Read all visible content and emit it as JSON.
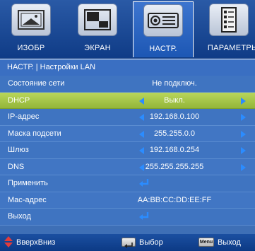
{
  "tabs": [
    {
      "label": "ИЗОБР",
      "icon": "image-settings-icon"
    },
    {
      "label": "ЭКРАН",
      "icon": "screen-icon"
    },
    {
      "label": "НАСТР.",
      "icon": "projector-icon"
    },
    {
      "label": "ПАРАМЕТРЫ",
      "icon": "options-list-icon"
    }
  ],
  "active_tab": "НАСТР.",
  "breadcrumb": "НАСТР. | Настройки LAN",
  "rows": [
    {
      "label": "Состояние сети",
      "value": "Не подключ."
    },
    {
      "label": "DHCP",
      "value": "Выкл."
    },
    {
      "label": "IP-адрес",
      "value": "192.168.0.100"
    },
    {
      "label": "Маска подсети",
      "value": "255.255.0.0"
    },
    {
      "label": "Шлюз",
      "value": "192.168.0.254"
    },
    {
      "label": "DNS",
      "value": "255.255.255.255"
    },
    {
      "label": "Применить",
      "value": ""
    },
    {
      "label": "Mac-адрес",
      "value": "AA:BB:CC:DD:EE:FF"
    },
    {
      "label": "Выход",
      "value": ""
    }
  ],
  "footer": {
    "updown_label": "ВверхВниз",
    "enter_label": "Выбор",
    "menu_key": "Menu",
    "menu_label": "Выход"
  },
  "colors": {
    "background": "#3e6fb6",
    "selected_row": "#a8c84c",
    "arrow": "#2b8cff",
    "updown_arrow": "#e23b3b"
  }
}
